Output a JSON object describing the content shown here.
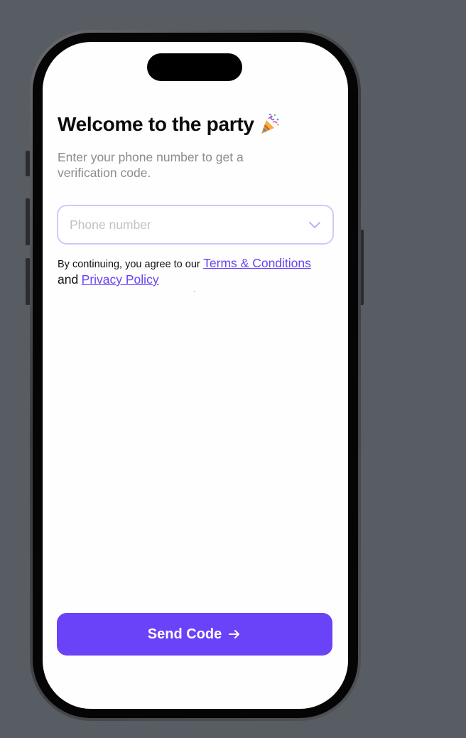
{
  "welcome": {
    "title": "Welcome to the party",
    "title_emoji": "party-popper-icon",
    "subtitle": "Enter your phone number to get a verification code."
  },
  "phone_input": {
    "placeholder": "Phone number",
    "value": ""
  },
  "terms": {
    "prefix": "By continuing, you agree to our",
    "terms_link": "Terms & Conditions",
    "conjunction": "and",
    "privacy_link": "Privacy Policy"
  },
  "send_button": {
    "label": "Send Code"
  },
  "colors": {
    "accent": "#6a42f8",
    "input_border": "#d2c8fb",
    "subtitle": "#8b8b90",
    "background": "#585c63"
  }
}
